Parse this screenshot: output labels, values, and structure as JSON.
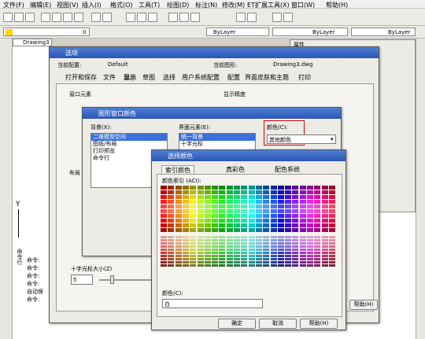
{
  "menu": [
    "文件(F)",
    "编辑(E)",
    "视图(V)",
    "插入(I)",
    "格式(O)",
    "工具(T)",
    "绘图(D)",
    "标注(N)",
    "修改(M)",
    "ET扩展工具(X)",
    "窗口(W)",
    "帮助(H)"
  ],
  "toolbar": {
    "layer_value": "0",
    "color_value": "ByLayer",
    "linetype_value": "ByLayer",
    "lineweight_value": "ByLayer",
    "properties_label": "属性"
  },
  "drawing_tab": "Drawing3",
  "options": {
    "title": "选项",
    "current_profile_label": "当前配置:",
    "current_profile": "Default",
    "current_drawing_label": "当前图形:",
    "current_drawing": "Drawing3.dwg",
    "tabs": [
      "打开和保存",
      "文件",
      "显示",
      "草图",
      "选择",
      "用户系统配置",
      "配置",
      "界面皮肤和主题",
      "打印"
    ],
    "group_window": "窗口元素",
    "group_display_precision": "显示精度",
    "group_layout": "布局",
    "crosshair_label": "十字光标大小(Z)",
    "crosshair_value": "5",
    "help_button": "帮助(H)"
  },
  "color_window": {
    "title": "图形窗口颜色",
    "bg_label": "背景(X):",
    "bg_items": [
      "二维模型空间",
      "图纸/布局",
      "打印预览",
      "命令行"
    ],
    "element_label": "界面元素(E):",
    "element_items": [
      "统一背景",
      "十字光标"
    ],
    "color_label": "颜色(C):",
    "color_value": "其他颜色"
  },
  "select_color": {
    "title": "选择颜色",
    "tabs": [
      "索引颜色",
      "真彩色",
      "配色系统"
    ],
    "aci_label": "颜色索引 (ACI):",
    "color_label": "颜色(C):",
    "color_value": "白",
    "ok": "确定",
    "cancel": "取消",
    "help": "帮助(H)"
  },
  "cmd": {
    "y_label": "Y",
    "lines": [
      "命令:",
      "命令:",
      "命令:",
      "命令:",
      "自动保",
      "命令:"
    ],
    "side_label": "命令行"
  }
}
